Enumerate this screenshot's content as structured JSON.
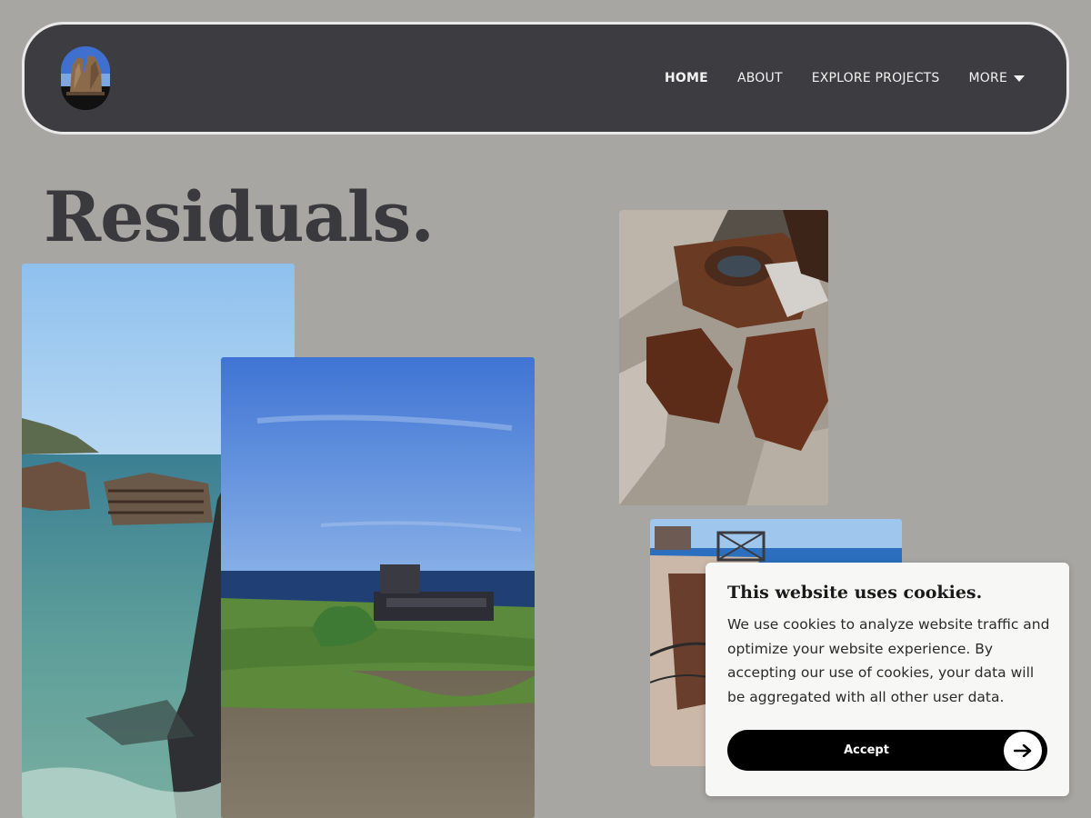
{
  "header": {
    "logo_alt": "site logo",
    "nav": [
      {
        "label": "HOME",
        "active": true
      },
      {
        "label": "ABOUT",
        "active": false
      },
      {
        "label": "EXPLORE PROJECTS",
        "active": false
      },
      {
        "label": "MORE",
        "active": false,
        "dropdown": true
      }
    ]
  },
  "hero": {
    "title": "Residuals."
  },
  "photos": [
    {
      "name": "shipwreck-coast-photo"
    },
    {
      "name": "beached-wreck-field-photo"
    },
    {
      "name": "rusted-metal-rocks-photo"
    },
    {
      "name": "industrial-ruins-photo"
    }
  ],
  "cookie_banner": {
    "title": "This website uses cookies.",
    "text": "We use cookies to analyze website traffic and optimize your website experience. By accepting our use of cookies, your data will be aggregated with all other user data.",
    "accept_label": "Accept",
    "accept_icon": "arrow-right-icon"
  },
  "colors": {
    "background": "#a8a6a3",
    "header": "#3c3c41",
    "header_border": "#e9e9ea",
    "title": "#3a3a3e",
    "banner": "#f7f7f6",
    "button": "#000000"
  }
}
